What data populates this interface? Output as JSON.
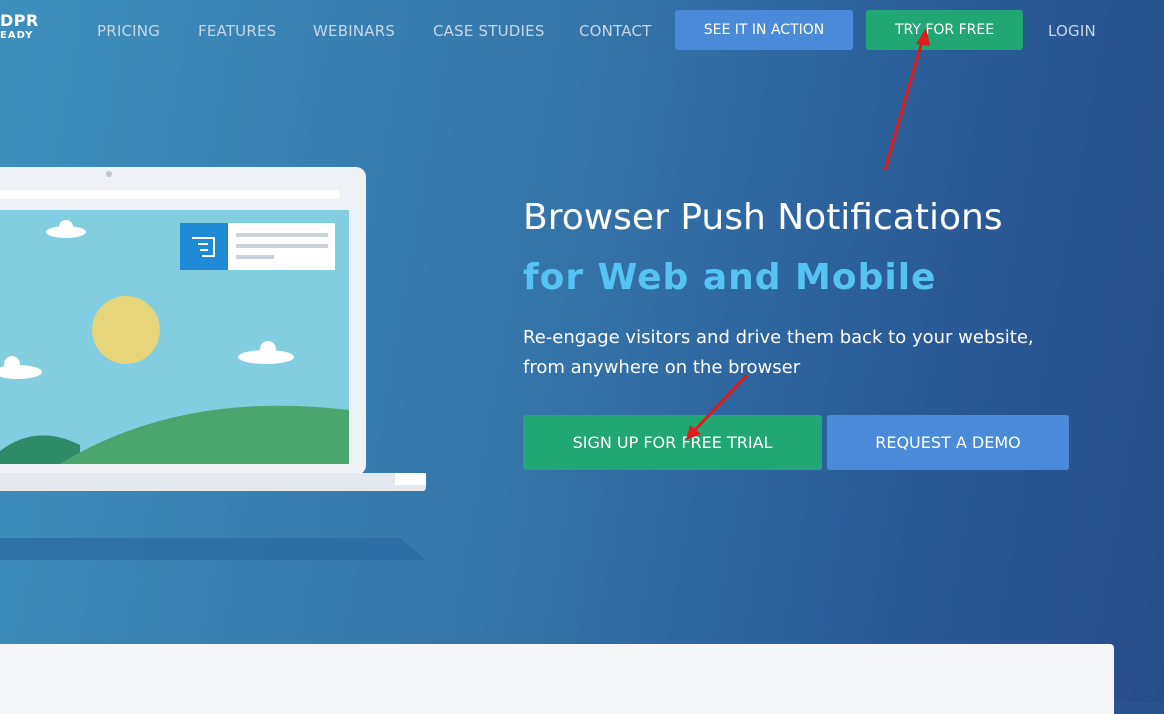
{
  "logo": {
    "line1": "DPR",
    "line2": "EADY"
  },
  "nav": {
    "links": [
      "PRICING",
      "FEATURES",
      "WEBINARS",
      "CASE STUDIES",
      "CONTACT"
    ],
    "see_it_in_action": "SEE IT IN ACTION",
    "try_for_free": "TRY FOR FREE",
    "login": "LOGIN"
  },
  "hero": {
    "title": "Browser Push Notifications",
    "subtitle": "for Web and Mobile",
    "description_line1": "Re-engage visitors and drive them back to your website,",
    "description_line2": "from anywhere on the browser",
    "primary_cta": "SIGN UP FOR FREE TRIAL",
    "secondary_cta": "REQUEST A DEMO"
  },
  "colors": {
    "accent_green": "#20a773",
    "accent_blue": "#4a8ad9",
    "subtitle_blue": "#56c4f3",
    "annotation_arrow": "#e01b1b"
  },
  "icons": [
    "laptop-illustration",
    "notification-icon",
    "annotation-arrow"
  ]
}
